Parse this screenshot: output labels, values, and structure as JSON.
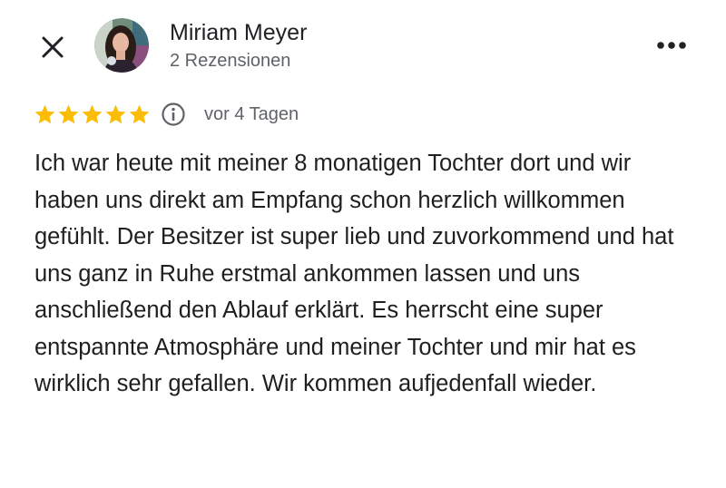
{
  "reviewer": {
    "name": "Miriam Meyer",
    "meta": "2 Rezensionen"
  },
  "review": {
    "rating": 5,
    "max_rating": 5,
    "date": "vor 4 Tagen",
    "text": "Ich war heute mit meiner 8 monatigen Tochter dort und wir haben uns direkt am Empfang schon herzlich willkommen gefühlt. Der Besitzer ist super lieb und zuvorkommend und hat uns ganz in Ruhe erstmal ankommen lassen und uns anschließend den Ablauf erklärt. Es herrscht eine super entspannte Atmosphäre und meiner Tochter und mir hat es wirklich sehr gefallen. Wir kommen aufjedenfall wieder."
  },
  "icons": {
    "close": "close-icon",
    "more": "more-horizontal-icon",
    "star": "star-icon",
    "info": "info-icon"
  },
  "colors": {
    "star": "#fbbc04",
    "text_primary": "#1f1f1f",
    "text_secondary": "#5f6368"
  }
}
